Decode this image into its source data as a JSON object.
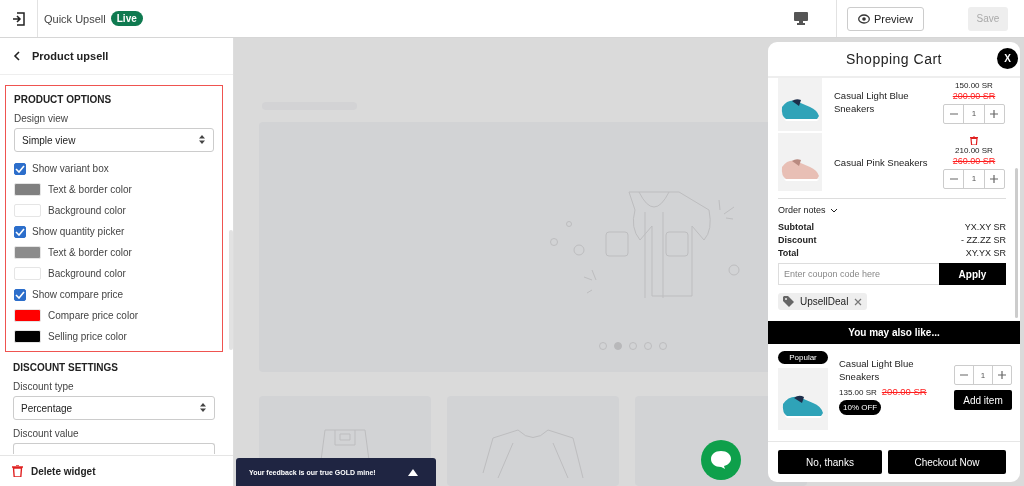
{
  "topbar": {
    "app_name": "Quick Upsell",
    "status": "Live",
    "preview_label": "Preview",
    "save": {
      "label": "Save",
      "disabled": true
    }
  },
  "panel": {
    "back_title": "Product upsell",
    "product_options": {
      "title": "PRODUCT OPTIONS",
      "design_view": {
        "label": "Design view",
        "value": "Simple view"
      },
      "items": [
        {
          "kind": "checkbox",
          "label": "Show variant box",
          "checked": true
        },
        {
          "kind": "color",
          "label": "Text & border color",
          "color": "#808080"
        },
        {
          "kind": "color",
          "label": "Background color",
          "color": "#ffffff"
        },
        {
          "kind": "checkbox",
          "label": "Show quantity picker",
          "checked": true
        },
        {
          "kind": "color",
          "label": "Text & border color",
          "color": "#8c8c8c"
        },
        {
          "kind": "color",
          "label": "Background color",
          "color": "#ffffff"
        },
        {
          "kind": "checkbox",
          "label": "Show compare price",
          "checked": true
        },
        {
          "kind": "color",
          "label": "Compare price color",
          "color": "#ff0000"
        },
        {
          "kind": "color",
          "label": "Selling price color",
          "color": "#000000"
        }
      ]
    },
    "discount_settings": {
      "title": "DISCOUNT SETTINGS",
      "discount_type": {
        "label": "Discount type",
        "value": "Percentage"
      },
      "discount_value": {
        "label": "Discount value"
      }
    },
    "delete_label": "Delete widget"
  },
  "preview": {
    "carousel_dots": [
      {
        "selected": false
      },
      {
        "selected": true
      },
      {
        "selected": false
      },
      {
        "selected": false
      },
      {
        "selected": false
      }
    ],
    "feedback": "Your feedback is our true GOLD mine!"
  },
  "cart": {
    "title": "Shopping Cart",
    "close": "X",
    "items": [
      {
        "name": "Casual Light Blue Sneakers",
        "price": "150.00 SR",
        "compare_price": "200.00 SR",
        "quantity": "1",
        "trash": false
      },
      {
        "name": "Casual Pink Sneakers",
        "price": "210.00 SR",
        "compare_price": "260.00 SR",
        "quantity": "1",
        "trash": true
      }
    ],
    "order_notes": "Order notes",
    "totals": [
      {
        "label": "Subtotal",
        "value": "YX.XY SR"
      },
      {
        "label": "Discount",
        "value": "- ZZ.ZZ SR"
      },
      {
        "label": "Total",
        "value": "XY.YX SR"
      }
    ],
    "coupon_placeholder": "Enter coupon code here",
    "apply": "Apply",
    "coupon_tag": "UpsellDeal",
    "upsell_heading": "You may also like...",
    "upsell": {
      "badge": "Popular",
      "name": "Casual Light Blue Sneakers",
      "price": "135.00 SR",
      "compare_price": "200.00 SR",
      "discount": "10% OFF",
      "quantity": "1",
      "add": "Add item"
    },
    "buttons": [
      "No, thanks",
      "Checkout Now"
    ]
  }
}
